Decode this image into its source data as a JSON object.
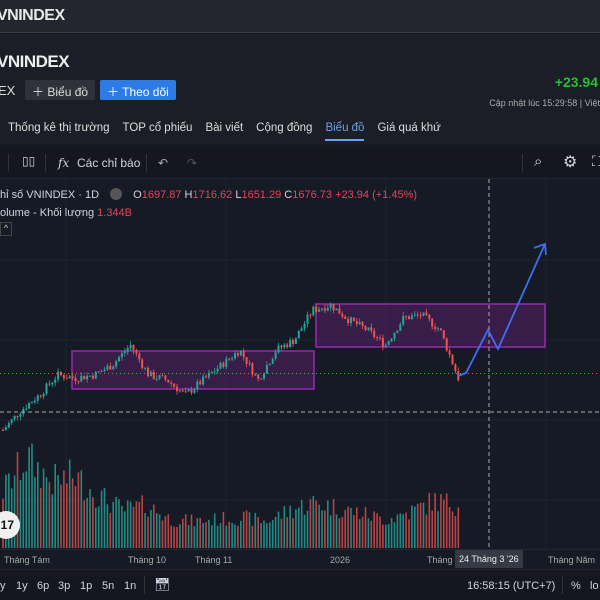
{
  "window_title": "VNINDEX",
  "header": {
    "title": "VNINDEX",
    "exchange": "EX",
    "chart_button": "Biểu đồ",
    "follow_button": "Theo dõi",
    "change": "+23.94",
    "updated": "Cập nhật lúc  15:29:58 | Việt"
  },
  "tabs": [
    {
      "label": "Thống kê thị trường"
    },
    {
      "label": "TOP cổ phiếu"
    },
    {
      "label": "Bài viết"
    },
    {
      "label": "Cộng đồng"
    },
    {
      "label": "Biểu đồ",
      "active": true
    },
    {
      "label": "Giá quá khứ"
    }
  ],
  "toolbar": {
    "indicators": "Các chỉ báo"
  },
  "legend": {
    "symbol": "hỉ số VNINDEX · 1D",
    "o_label": "O",
    "open": "1697.87",
    "h_label": "H",
    "high": "1716.62",
    "l_label": "L",
    "low": "1651.29",
    "c_label": "C",
    "close": "1676.73",
    "change": "+23.94 (+1.45%)",
    "volume_label": "olume - Khối lượng",
    "volume": "1.344B"
  },
  "time_axis": {
    "labels": [
      "Tháng Tám",
      "Tháng 10",
      "Tháng 11",
      "2026",
      "Tháng",
      "Tháng Năm"
    ],
    "crosshair": "24 Tháng 3 '26"
  },
  "bottom": {
    "ranges": [
      "y",
      "1y",
      "6p",
      "3p",
      "1p",
      "5n",
      "1n"
    ],
    "time": "16:58:15 (UTC+7)",
    "percent": "%",
    "log": "lo"
  },
  "colors": {
    "up": "#26a69a",
    "down": "#ef5350",
    "box": "#9c27b0",
    "projection": "#3d6ff0"
  },
  "chart_data": {
    "type": "candlestick",
    "close_keypoints": [
      1573,
      1613,
      1643,
      1683,
      1677,
      1683,
      1703,
      1743,
      1683,
      1673,
      1643,
      1673,
      1703,
      1733,
      1673,
      1733,
      1753,
      1813,
      1823,
      1793,
      1773,
      1743,
      1797,
      1803,
      1773,
      1677
    ],
    "boxes": [
      {
        "from_price": 1655,
        "to_price": 1731
      },
      {
        "from_price": 1739,
        "to_price": 1825
      }
    ],
    "projection": [
      1681,
      1687,
      1773,
      1735,
      1945
    ],
    "last_price": 1686,
    "volume_keypoints": [
      60,
      95,
      70,
      75,
      55,
      40,
      45,
      30,
      28,
      30,
      32,
      28,
      40,
      48,
      42,
      36,
      30,
      38,
      50,
      45
    ]
  }
}
